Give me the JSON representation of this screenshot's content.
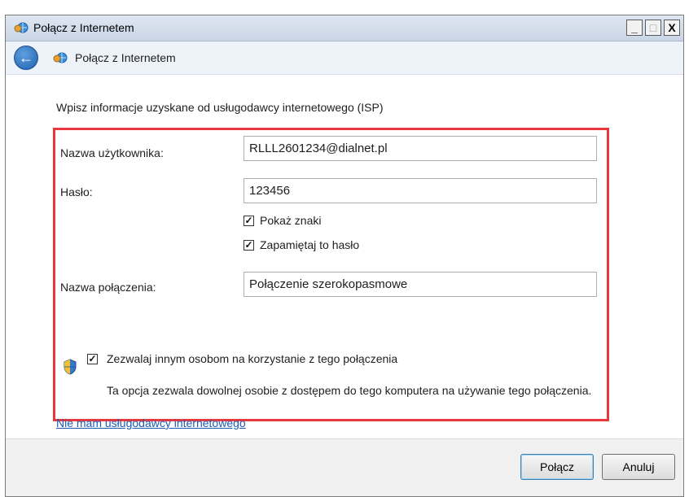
{
  "window": {
    "title": "Połącz z Internetem",
    "controls": {
      "minimize": "_",
      "maximize": "□",
      "close": "X"
    }
  },
  "nav": {
    "back": "←",
    "title": "Połącz z Internetem"
  },
  "instruction": "Wpisz informacje uzyskane od usługodawcy internetowego (ISP)",
  "form": {
    "username": {
      "label": "Nazwa użytkownika:",
      "value": "RLLL2601234@dialnet.pl"
    },
    "password": {
      "label": "Hasło:",
      "value": "123456"
    },
    "show_chars": {
      "label": "Pokaż znaki",
      "checked": true
    },
    "remember": {
      "label": "Zapamiętaj to hasło",
      "checked": true
    },
    "connection_name": {
      "label": "Nazwa połączenia:",
      "value": "Połączenie szerokopasmowe"
    },
    "allow_others": {
      "label": "Zezwalaj innym osobom na korzystanie z tego połączenia",
      "checked": true
    },
    "allow_desc": "Ta opcja zezwala dowolnej osobie z dostępem do tego komputera na używanie tego połączenia."
  },
  "link": "Nie mam usługodawcy internetowego",
  "buttons": {
    "connect": "Połącz",
    "cancel": "Anuluj"
  },
  "check_mark": "✓",
  "colors": {
    "highlight": "#e8383d",
    "link": "#1c5ab5",
    "titlebar": "#c9d6e6"
  },
  "icons": {
    "app": "network-globe-icon",
    "back": "back-arrow-icon",
    "shield": "uac-shield-icon"
  }
}
